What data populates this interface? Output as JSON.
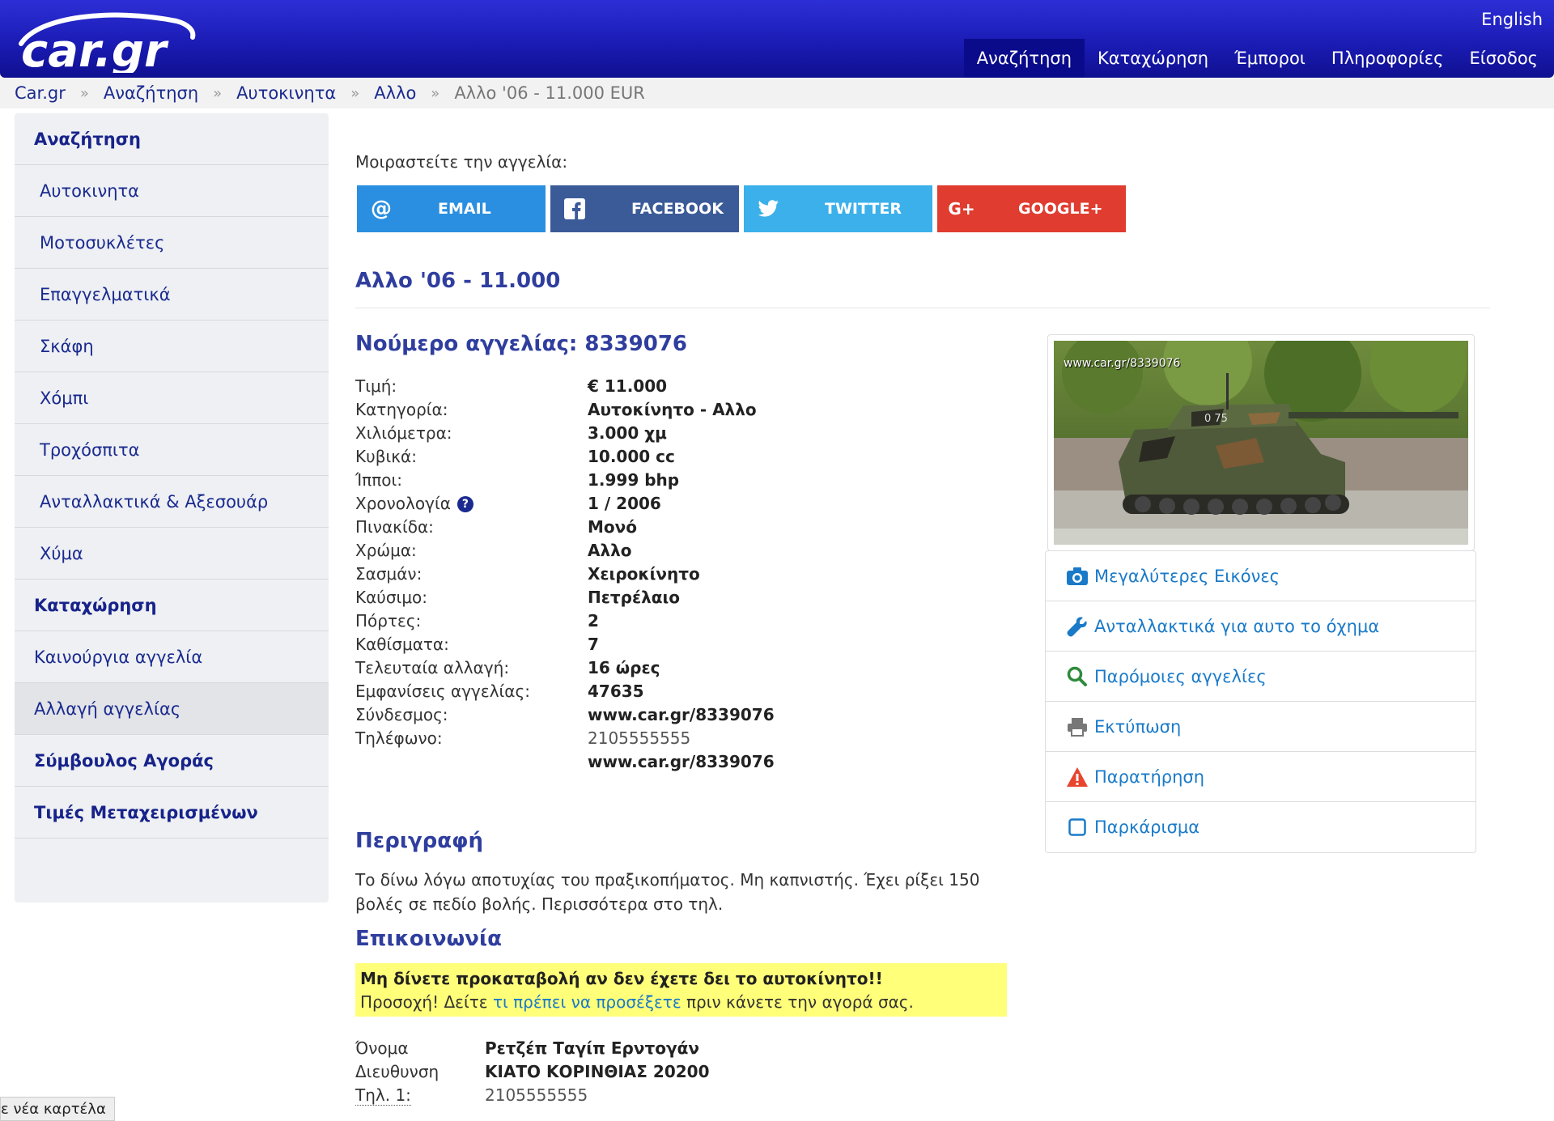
{
  "header": {
    "logo_text": "car.gr",
    "lang": "English",
    "nav": [
      "Αναζήτηση",
      "Καταχώρηση",
      "Έμποροι",
      "Πληροφορίες",
      "Είσοδος"
    ]
  },
  "breadcrumb": {
    "items": [
      "Car.gr",
      "Αναζήτηση",
      "Αυτοκινητα",
      "Αλλο"
    ],
    "current": "Αλλο '06 - 11.000 EUR"
  },
  "sidebar": {
    "items": [
      "Αναζήτηση",
      "Αυτοκινητα",
      "Μοτοσυκλέτες",
      "Επαγγελματικά",
      "Σκάφη",
      "Χόμπι",
      "Τροχόσπιτα",
      "Ανταλλακτικά & Αξεσουάρ",
      "Χύμα",
      "Καταχώρηση",
      "Καινούργια αγγελία",
      "Αλλαγή αγγελίας",
      "Σύμβουλος Αγοράς",
      "Τιμές Μεταχειρισμένων"
    ]
  },
  "share": {
    "label": "Μοιραστείτε την αγγελία:",
    "email": "EMAIL",
    "facebook": "FACEBOOK",
    "twitter": "TWITTER",
    "google": "GOOGLE+"
  },
  "listing": {
    "title": "Αλλο '06 - 11.000",
    "ad_number": "Νούμερο αγγελίας: 8339076",
    "specs": [
      {
        "k": "Τιμή:",
        "v": "€ 11.000"
      },
      {
        "k": "Κατηγορία:",
        "v": "Αυτοκίνητο - Αλλο"
      },
      {
        "k": "Χιλιόμετρα:",
        "v": "3.000 χμ"
      },
      {
        "k": "Κυβικά:",
        "v": "10.000 cc"
      },
      {
        "k": "Ίπποι:",
        "v": "1.999 bhp"
      },
      {
        "k": "Χρονολογία",
        "v": "1 / 2006"
      },
      {
        "k": "Πινακίδα:",
        "v": "Μονό"
      },
      {
        "k": "Χρώμα:",
        "v": "Αλλο"
      },
      {
        "k": "Σασμάν:",
        "v": "Χειροκίνητο"
      },
      {
        "k": "Καύσιμο:",
        "v": "Πετρέλαιο"
      },
      {
        "k": "Πόρτες:",
        "v": "2"
      },
      {
        "k": "Καθίσματα:",
        "v": "7"
      },
      {
        "k": "Τελευταία αλλαγή:",
        "v": "16 ώρες"
      },
      {
        "k": "Εμφανίσεις αγγελίας:",
        "v": "47635"
      },
      {
        "k": "Σύνδεσμος:",
        "v": "www.car.gr/8339076"
      },
      {
        "k": "Τηλέφωνο:",
        "v": "2105555555"
      },
      {
        "k": "",
        "v": "www.car.gr/8339076"
      }
    ],
    "help_glyph": "?",
    "description_heading": "Περιγραφή",
    "description": "Το δίνω λόγω αποτυχίας του πραξικοπήματος. Μη καπνιστής. Έχει ρίξει 150 βολές σε πεδίο βολής. Περισσότερα στο τηλ.",
    "contact_heading": "Επικοινωνία",
    "warning_bold": "Μη δίνετε προκαταβολή αν δεν έχετε δει το αυτοκίνητο!!",
    "warning_pre": "Προσοχή! Δείτε ",
    "warning_link": "τι πρέπει να προσέξετε",
    "warning_post": " πριν κάνετε την αγορά σας.",
    "contacts": [
      {
        "k": "Όνομα",
        "v": "Ρετζέπ Ταγίπ Ερντογάν"
      },
      {
        "k": "Διευθυνση",
        "v": "ΚΙΑΤΟ ΚΟΡΙΝΘΙΑΣ 20200"
      },
      {
        "k": "Τηλ. 1:",
        "v": "2105555555"
      }
    ]
  },
  "photo": {
    "watermark": "www.car.gr/8339076",
    "turret_number": "0 75"
  },
  "actions": [
    {
      "label": "Μεγαλύτερες Εικόνες",
      "icon": "camera-icon"
    },
    {
      "label": "Ανταλλακτικά για αυτο το όχημα",
      "icon": "wrench-icon"
    },
    {
      "label": "Παρόμοιες αγγελίες",
      "icon": "search-icon"
    },
    {
      "label": "Εκτύπωση",
      "icon": "printer-icon"
    },
    {
      "label": "Παρατήρηση",
      "icon": "warning-icon"
    },
    {
      "label": "Παρκάρισμα",
      "icon": "checkbox-icon"
    }
  ],
  "status_tooltip": "ε νέα καρτέλα",
  "colors": {
    "header": "#1b1cb5",
    "link": "#1a7ac8",
    "heading": "#2f3e9e",
    "email": "#2a8fe0",
    "facebook": "#3b5b98",
    "twitter": "#3bb0ea",
    "google": "#e03c30",
    "warning_bg": "#ffff7a"
  }
}
